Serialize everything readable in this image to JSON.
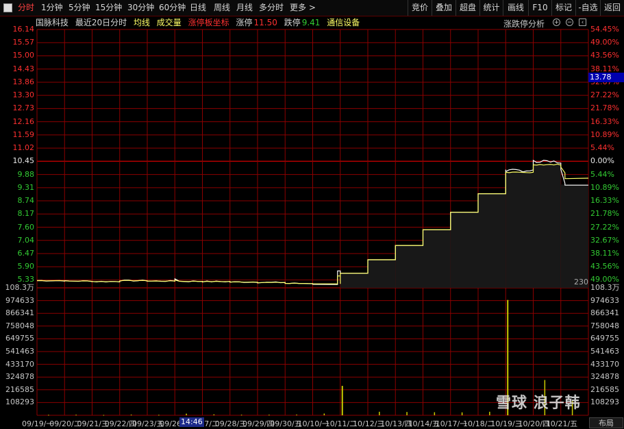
{
  "toolbar": {
    "tabs": [
      {
        "label": "分时",
        "active": true
      },
      {
        "label": "1分钟"
      },
      {
        "label": "5分钟"
      },
      {
        "label": "15分钟"
      },
      {
        "label": "30分钟"
      },
      {
        "label": "60分钟"
      },
      {
        "label": "日线"
      },
      {
        "label": "周线"
      },
      {
        "label": "月线"
      },
      {
        "label": "多分时"
      },
      {
        "label": "更多 >"
      }
    ],
    "right_buttons": [
      "竞价",
      "叠加",
      "超盘",
      "统计",
      "画线",
      "F10",
      "标记",
      "-自选",
      "返回"
    ]
  },
  "info": {
    "stock_name": "国脉科技",
    "period": "最近20日分时",
    "avg_line": "均线",
    "volume": "成交量",
    "limit_axis": "涨停板坐标",
    "limit_up_label": "涨停",
    "limit_up_value": "11.50",
    "limit_down_label": "跌停",
    "limit_down_value": "9.41",
    "sector": "通信设备",
    "analysis": "涨跌停分析"
  },
  "colors": {
    "grid": "#8b0000",
    "price_line": "#ffffff",
    "avg_line": "#ffff66",
    "up": "#ff3030",
    "down": "#33cc33",
    "neutral": "#c8c8c8",
    "volume": "#cccc00"
  },
  "price_axis_left": [
    "16.14",
    "15.57",
    "15.00",
    "14.43",
    "13.86",
    "13.30",
    "12.73",
    "12.16",
    "11.59",
    "11.02",
    "10.45",
    "9.88",
    "9.31",
    "8.74",
    "8.17",
    "7.60",
    "7.04",
    "6.47",
    "5.90",
    "5.33"
  ],
  "price_axis_right": [
    "54.45%",
    "49.00%",
    "43.56%",
    "38.11%",
    "32.67%",
    "27.22%",
    "21.78%",
    "16.33%",
    "10.89%",
    "5.44%",
    "0.00%",
    "5.44%",
    "10.89%",
    "16.33%",
    "21.78%",
    "27.22%",
    "32.67%",
    "38.11%",
    "43.56%",
    "49.00%"
  ],
  "volume_axis_left": [
    "108.3万",
    "974633",
    "866341",
    "758048",
    "649755",
    "541463",
    "433170",
    "324878",
    "216585",
    "108293"
  ],
  "volume_axis_right": [
    "108.3万",
    "974633",
    "866341",
    "758048",
    "649755",
    "541463",
    "433170",
    "324878",
    "216585",
    "108293"
  ],
  "dates": [
    "09/19/一",
    "09/20/二",
    "09/21/三",
    "09/22/四",
    "09/23/五",
    "09/26/一",
    "09/27/二",
    "09/28/三",
    "09/29/四",
    "09/30/五",
    "10/10/一",
    "10/11/二",
    "10/12/三",
    "10/13/四",
    "10/14/五",
    "10/17/一",
    "10/18/二",
    "10/19/三",
    "10/20/四",
    "10/21/五"
  ],
  "current_price_tag": "13.78",
  "cursor_time": "14:46",
  "count_label": "230",
  "layout_button": "布局",
  "watermark": "雪球 浪子韩",
  "chart_data": {
    "type": "line",
    "x": [
      "09/19",
      "09/20",
      "09/21",
      "09/22",
      "09/23",
      "09/26",
      "09/27",
      "09/28",
      "09/29",
      "09/30",
      "10/10",
      "10/11",
      "10/12",
      "10/13",
      "10/14",
      "10/17",
      "10/18",
      "10/19",
      "10/20",
      "10/21"
    ],
    "series": [
      {
        "name": "均线",
        "values": [
          5.3,
          5.28,
          5.26,
          5.3,
          5.28,
          5.27,
          5.26,
          5.24,
          5.22,
          5.18,
          5.16,
          5.62,
          6.2,
          6.82,
          7.5,
          8.25,
          9.05,
          9.97,
          10.3,
          9.45
        ]
      },
      {
        "name": "成交量",
        "values": [
          4000,
          5000,
          3000,
          6000,
          4000,
          14000,
          8000,
          5000,
          5000,
          6000,
          15000,
          250000,
          30000,
          28000,
          26000,
          25000,
          30000,
          980000,
          300000,
          120000
        ]
      }
    ],
    "ylim_price": [
      5.33,
      16.14
    ],
    "ylim_volume": [
      0,
      1083000
    ],
    "reference_price": 10.45,
    "grid": true
  }
}
